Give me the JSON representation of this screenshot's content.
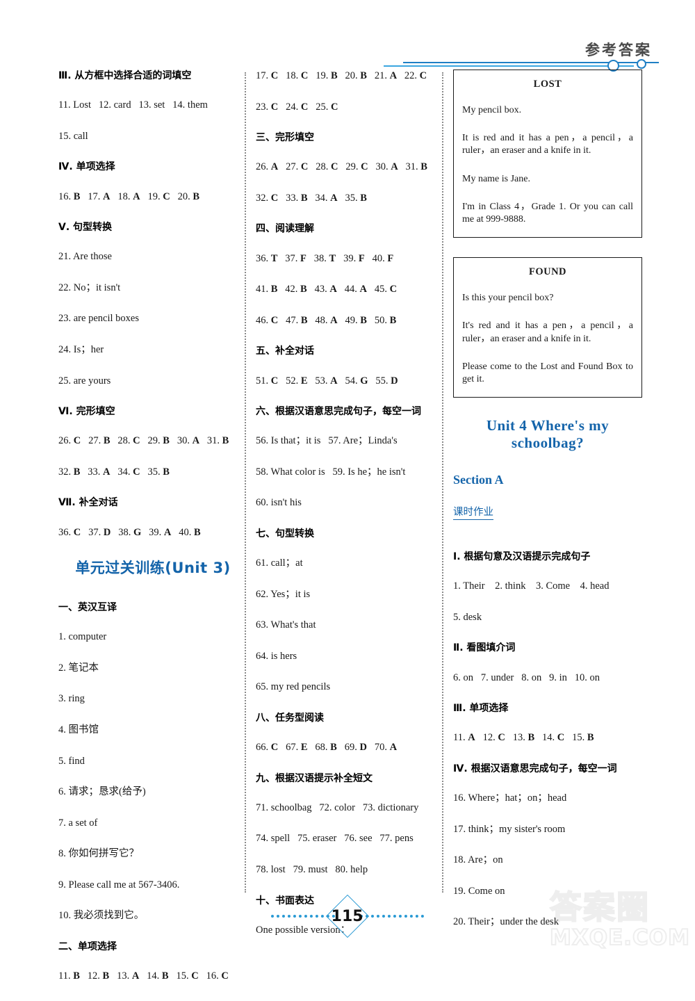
{
  "header": {
    "title": "参考答案"
  },
  "footer": {
    "page_number": "115"
  },
  "watermark": {
    "cjk": "答案圈",
    "latin": "MXQE.COM"
  },
  "column1": {
    "blocks": [
      {
        "kind": "section-head",
        "text": "Ⅲ. 从方框中选择合适的词填空"
      },
      {
        "kind": "answers",
        "text": "11. Lost   12. card   13. set   14. them"
      },
      {
        "kind": "answers",
        "text": "15. call"
      },
      {
        "kind": "section-head",
        "text": "Ⅳ. 单项选择"
      },
      {
        "kind": "answers",
        "text": "16. B   17. A   18. A   19. C   20. B"
      },
      {
        "kind": "section-head",
        "text": "Ⅴ. 句型转换"
      },
      {
        "kind": "answers",
        "text": "21. Are those"
      },
      {
        "kind": "answers",
        "text": "22. No；it isn't"
      },
      {
        "kind": "answers",
        "text": "23. are pencil boxes"
      },
      {
        "kind": "answers",
        "text": "24. Is；her"
      },
      {
        "kind": "answers",
        "text": "25. are yours"
      },
      {
        "kind": "section-head",
        "text": "Ⅵ. 完形填空"
      },
      {
        "kind": "answers",
        "text": "26. C   27. B   28. C   29. B   30. A   31. B"
      },
      {
        "kind": "answers",
        "text": "32. B   33. A   34. C   35. B"
      },
      {
        "kind": "section-head",
        "text": "Ⅶ. 补全对话"
      },
      {
        "kind": "answers",
        "text": "36. C   37. D   38. G   39. A   40. B"
      },
      {
        "kind": "unit-training-title",
        "text": "单元过关训练(Unit 3)"
      },
      {
        "kind": "section-head",
        "text": "一、英汉互译"
      },
      {
        "kind": "answers",
        "text": "1. computer"
      },
      {
        "kind": "answers",
        "text": "2. 笔记本"
      },
      {
        "kind": "answers",
        "text": "3. ring"
      },
      {
        "kind": "answers",
        "text": "4. 图书馆"
      },
      {
        "kind": "answers",
        "text": "5. find"
      },
      {
        "kind": "answers",
        "text": "6. 请求；恳求(给予)"
      },
      {
        "kind": "answers",
        "text": "7. a set of"
      },
      {
        "kind": "answers",
        "text": "8. 你如何拼写它？"
      },
      {
        "kind": "answers",
        "text": "9. Please call me at 567-3406."
      },
      {
        "kind": "answers",
        "text": "10. 我必须找到它。"
      },
      {
        "kind": "section-head",
        "text": "二、单项选择"
      },
      {
        "kind": "answers",
        "text": "11. B   12. B   13. A   14. B   15. C   16. C"
      }
    ]
  },
  "column2": {
    "blocks": [
      {
        "kind": "answers",
        "text": "17. C   18. C   19. B   20. B   21. A   22. C"
      },
      {
        "kind": "answers",
        "text": "23. C   24. C   25. C"
      },
      {
        "kind": "section-head",
        "text": "三、完形填空"
      },
      {
        "kind": "answers",
        "text": "26. A   27. C   28. C   29. C   30. A   31. B"
      },
      {
        "kind": "answers",
        "text": "32. C   33. B   34. A   35. B"
      },
      {
        "kind": "section-head",
        "text": "四、阅读理解"
      },
      {
        "kind": "answers",
        "text": "36. T   37. F   38. T   39. F   40. F"
      },
      {
        "kind": "answers",
        "text": "41. B   42. B   43. A   44. A   45. C"
      },
      {
        "kind": "answers",
        "text": "46. C   47. B   48. A   49. B   50. B"
      },
      {
        "kind": "section-head",
        "text": "五、补全对话"
      },
      {
        "kind": "answers",
        "text": "51. C   52. E   53. A   54. G   55. D"
      },
      {
        "kind": "section-head",
        "text": "六、根据汉语意思完成句子，每空一词"
      },
      {
        "kind": "answers",
        "text": "56. Is that；it is   57. Are；Linda's"
      },
      {
        "kind": "answers",
        "text": "58. What color is   59. Is he；he isn't"
      },
      {
        "kind": "answers",
        "text": "60. isn't his"
      },
      {
        "kind": "section-head",
        "text": "七、句型转换"
      },
      {
        "kind": "answers",
        "text": "61. call；at"
      },
      {
        "kind": "answers",
        "text": "62. Yes；it is"
      },
      {
        "kind": "answers",
        "text": "63. What's that"
      },
      {
        "kind": "answers",
        "text": "64. is hers"
      },
      {
        "kind": "answers",
        "text": "65. my red pencils"
      },
      {
        "kind": "section-head",
        "text": "八、任务型阅读"
      },
      {
        "kind": "answers",
        "text": "66. C   67. E   68. B   69. D   70. A"
      },
      {
        "kind": "section-head",
        "text": "九、根据汉语提示补全短文"
      },
      {
        "kind": "answers",
        "text": "71. schoolbag   72. color   73. dictionary"
      },
      {
        "kind": "answers",
        "text": "74. spell   75. eraser   76. see   77. pens"
      },
      {
        "kind": "answers",
        "text": "78. lost   79. must   80. help"
      },
      {
        "kind": "section-head",
        "text": "十、书面表达"
      },
      {
        "kind": "answers",
        "text": "One possible version："
      }
    ]
  },
  "column3": {
    "lost_notice": {
      "title": "LOST",
      "lines": [
        "My pencil box.",
        "It is red and it has a pen，a pencil，a ruler，an eraser and a knife in it.",
        "My name is Jane.",
        "I'm in Class 4，Grade 1. Or you can call me at 999-9888."
      ]
    },
    "found_notice": {
      "title": "FOUND",
      "lines": [
        "Is this your pencil box?",
        "It's red and it has a pen，a pencil，a ruler，an eraser and a knife in it.",
        "Please come to the Lost and Found Box to get it."
      ]
    },
    "unit_title": "Unit 4   Where's my schoolbag?",
    "section_title": "Section A",
    "homework_label": "课时作业",
    "blocks": [
      {
        "kind": "section-head",
        "text": "Ⅰ. 根据句意及汉语提示完成句子"
      },
      {
        "kind": "answers",
        "text": "1. Their    2. think    3. Come    4. head"
      },
      {
        "kind": "answers",
        "text": "5. desk"
      },
      {
        "kind": "section-head",
        "text": "Ⅱ. 看图填介词"
      },
      {
        "kind": "answers",
        "text": "6. on   7. under   8. on   9. in   10. on"
      },
      {
        "kind": "section-head",
        "text": "Ⅲ. 单项选择"
      },
      {
        "kind": "answers",
        "text": "11. A   12. C   13. B   14. C   15. B"
      },
      {
        "kind": "section-head",
        "text": "Ⅳ. 根据汉语意思完成句子，每空一词"
      },
      {
        "kind": "answers",
        "text": "16. Where；hat；on；head"
      },
      {
        "kind": "answers",
        "text": "17. think；my sister's room"
      },
      {
        "kind": "answers",
        "text": "18. Are；on"
      },
      {
        "kind": "answers",
        "text": "19. Come on"
      },
      {
        "kind": "answers",
        "text": "20. Their；under the desk"
      }
    ]
  },
  "colors": {
    "heading_blue": "#1464aa",
    "rule_blue": "#1f7fc4",
    "footer_blue": "#2a9ad4"
  }
}
